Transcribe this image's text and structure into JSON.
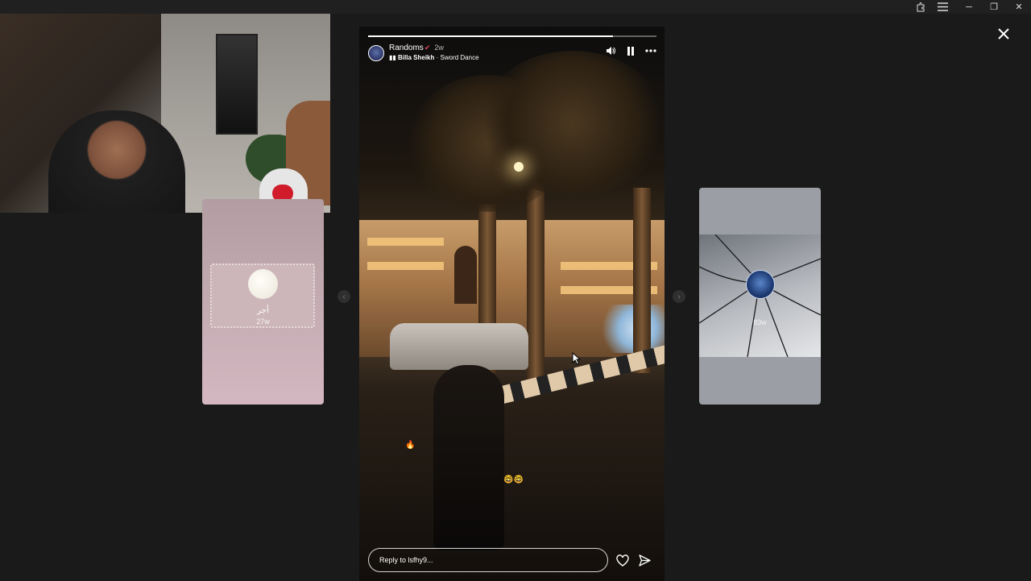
{
  "window": {
    "controls": {
      "minimize": "─",
      "restore": "❐",
      "close": "✕"
    },
    "icons": [
      "extension-icon",
      "menu-icon"
    ]
  },
  "viewer": {
    "close_icon": "close-icon",
    "prev_icon": "chevron-left-icon",
    "next_icon": "chevron-right-icon"
  },
  "left_story": {
    "name": "أجر",
    "time": "27w"
  },
  "right_story": {
    "time": "83w"
  },
  "main_story": {
    "progress": 0.85,
    "username": "Randoms",
    "verified_mark": "✔",
    "age": "2w",
    "music": {
      "icon": "music-bars-icon",
      "artist": "Billa Sheikh",
      "separator": " · ",
      "song": "Sword Dance"
    },
    "controls": [
      "volume-icon",
      "pause-icon",
      "more-icon"
    ],
    "emoji": "🤓🤓",
    "reply_placeholder": "Reply to lsfhy9...",
    "actions": [
      "like-icon",
      "share-icon"
    ]
  }
}
